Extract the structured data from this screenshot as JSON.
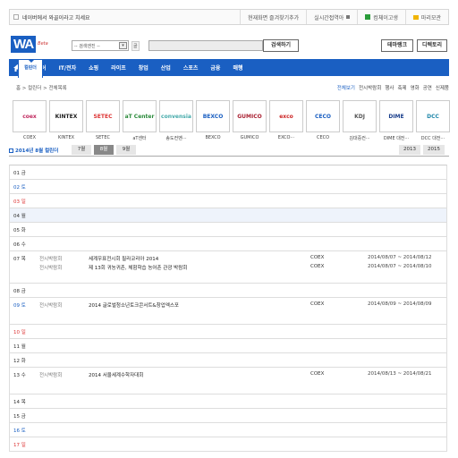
{
  "topbar": {
    "left_text": "네이버에서 와골이라고 치세요",
    "bookmark": "현재화면 즐겨찾기추가",
    "realtime": "실시간접역아",
    "login": "컴체이고생",
    "blog": "마리모관"
  },
  "header": {
    "logo": "WA",
    "logo_sub": "gol",
    "beta": "Beta",
    "search_select": "-- 검색엔진 --",
    "search_select_arrow": "▾",
    "search_label": "골",
    "search_value": "",
    "search_button": "검색하기",
    "btn_theme": "테마랭크",
    "btn_directory": "디렉토리"
  },
  "nav": {
    "items": [
      "미디어",
      "IT/전자",
      "쇼핑",
      "라이프",
      "창업",
      "산업",
      "스포츠",
      "금융",
      "매행"
    ],
    "calendar": "컬린더"
  },
  "breadcrumb": "홈 > 컬린더 > 전체목록",
  "filters": {
    "items": [
      "전체보기",
      "전시박람회",
      "행사",
      "축제",
      "영화",
      "공연",
      "신제품"
    ]
  },
  "venues": [
    {
      "name": "COEX",
      "logo": "coex",
      "color": "#c0285e"
    },
    {
      "name": "KINTEX",
      "logo": "KINTEX",
      "color": "#222"
    },
    {
      "name": "SETEC",
      "logo": "SETEC",
      "color": "#d33"
    },
    {
      "name": "aT센터",
      "logo": "aT Center",
      "color": "#2a8a3a"
    },
    {
      "name": "송도컨벤···",
      "logo": "convensia",
      "color": "#4aa"
    },
    {
      "name": "BEXCO",
      "logo": "BEXCO",
      "color": "#1a5fc2"
    },
    {
      "name": "GUMICO",
      "logo": "GUMICO",
      "color": "#a23"
    },
    {
      "name": "EXCO···",
      "logo": "exco",
      "color": "#c22"
    },
    {
      "name": "CECO",
      "logo": "CECO",
      "color": "#1a5fc2"
    },
    {
      "name": "김대중컨···",
      "logo": "KDJ",
      "color": "#555"
    },
    {
      "name": "DIME 대전···",
      "logo": "DIME",
      "color": "#1a3f8c"
    },
    {
      "name": "DCC 대전···",
      "logo": "DCC",
      "color": "#28a"
    }
  ],
  "month_bar": {
    "title": "2014년 8월 컬린더",
    "tabs": [
      "7월",
      "8월",
      "9월"
    ],
    "active_tab": "8월",
    "years": [
      "2013",
      "2015"
    ]
  },
  "days": [
    {
      "label": "01 금",
      "type": "normal",
      "events": []
    },
    {
      "label": "02 토",
      "type": "sat",
      "events": []
    },
    {
      "label": "03 일",
      "type": "sun",
      "events": []
    },
    {
      "label": "04 월",
      "type": "normal",
      "highlight": true,
      "events": []
    },
    {
      "label": "05 화",
      "type": "normal",
      "events": []
    },
    {
      "label": "06 수",
      "type": "normal",
      "events": []
    },
    {
      "label": "07 목",
      "type": "normal",
      "events": [
        {
          "cat": "전시박람회",
          "title": "세계우표전시회 필라코리아 2014",
          "venue": "COEX",
          "date": "2014/08/07 ~ 2014/08/12"
        },
        {
          "cat": "전시박람회",
          "title": "제 13회 귀농귀촌, 체험학습 농어촌 관광 박람회",
          "venue": "COEX",
          "date": "2014/08/07 ~ 2014/08/10"
        }
      ]
    },
    {
      "label": "08 금",
      "type": "normal",
      "events": []
    },
    {
      "label": "09 토",
      "type": "sat",
      "events": [
        {
          "cat": "전시박람회",
          "title": "2014 글로벌청소년토크콘서트&창업엑스포",
          "venue": "COEX",
          "date": "2014/08/09 ~ 2014/08/09"
        }
      ]
    },
    {
      "label": "10 일",
      "type": "sun",
      "events": []
    },
    {
      "label": "11 월",
      "type": "normal",
      "events": []
    },
    {
      "label": "12 화",
      "type": "normal",
      "events": []
    },
    {
      "label": "13 수",
      "type": "normal",
      "events": [
        {
          "cat": "전시박람회",
          "title": "2014 서울세계수학자대회",
          "venue": "COEX",
          "date": "2014/08/13 ~ 2014/08/21"
        }
      ]
    },
    {
      "label": "14 목",
      "type": "normal",
      "events": []
    },
    {
      "label": "15 금",
      "type": "normal",
      "events": []
    },
    {
      "label": "16 토",
      "type": "sat",
      "events": []
    },
    {
      "label": "17 일",
      "type": "sun",
      "events": []
    }
  ]
}
